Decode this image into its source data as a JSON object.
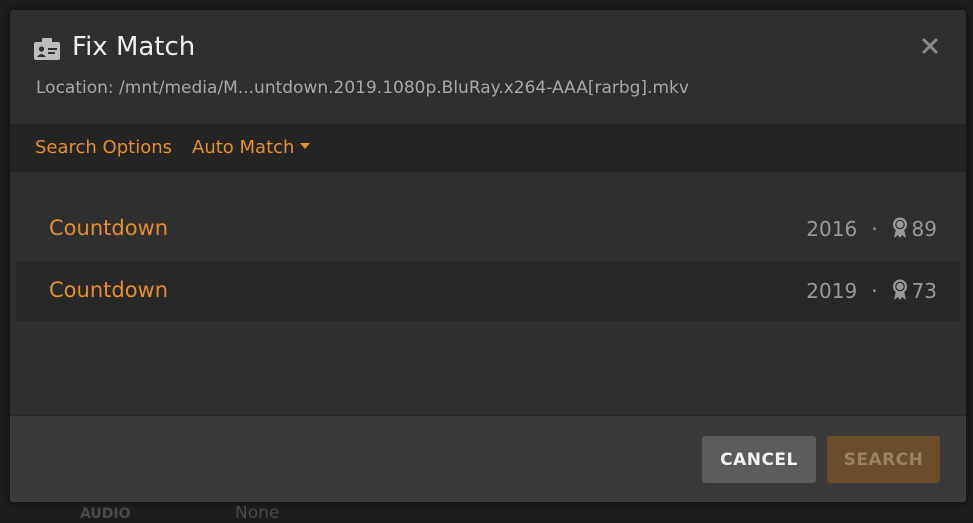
{
  "background": {
    "audio_label": "AUDIO",
    "audio_value": "None"
  },
  "dialog": {
    "title": "Fix Match",
    "title_icon": "id-card-icon",
    "close_icon": "close-icon",
    "location": "Location: /mnt/media/M...untdown.2019.1080p.BluRay.x264-AAA[rarbg].mkv"
  },
  "toolbar": {
    "search_options_label": "Search Options",
    "auto_match_label": "Auto Match"
  },
  "results": [
    {
      "title": "Countdown",
      "year": "2016",
      "separator": "·",
      "score": "89"
    },
    {
      "title": "Countdown",
      "year": "2019",
      "separator": "·",
      "score": "73"
    }
  ],
  "footer": {
    "cancel_label": "CANCEL",
    "search_label": "SEARCH"
  },
  "colors": {
    "accent": "#e58e2e",
    "modal_bg": "#2f2f2f",
    "toolbar_bg": "#242424",
    "footer_bg": "#3a3a3a"
  }
}
